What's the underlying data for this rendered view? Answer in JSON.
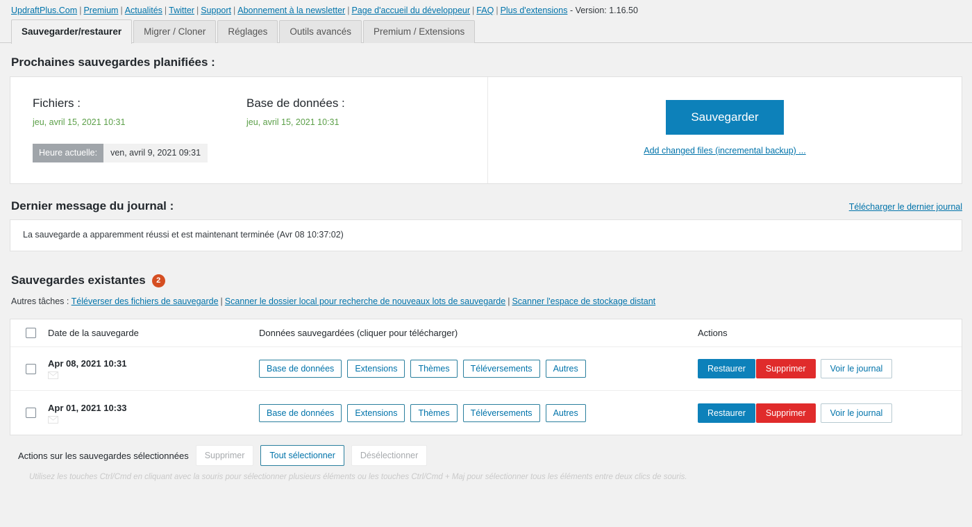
{
  "topbar": {
    "links": [
      "UpdraftPlus.Com",
      "Premium",
      "Actualités",
      "Twitter",
      "Support",
      "Abonnement à la newsletter",
      "Page d'accueil du développeur",
      "FAQ",
      "Plus d'extensions"
    ],
    "separator": "|",
    "version": "- Version: 1.16.50"
  },
  "tabs": [
    {
      "label": "Sauvegarder/restaurer",
      "active": true
    },
    {
      "label": "Migrer / Cloner",
      "active": false
    },
    {
      "label": "Réglages",
      "active": false
    },
    {
      "label": "Outils avancés",
      "active": false
    },
    {
      "label": "Premium / Extensions",
      "active": false
    }
  ],
  "scheduled": {
    "title": "Prochaines sauvegardes planifiées :",
    "files": {
      "label": "Fichiers :",
      "date": "jeu, avril 15, 2021 10:31"
    },
    "database": {
      "label": "Base de données :",
      "date": "jeu, avril 15, 2021 10:31"
    },
    "current_time": {
      "label": "Heure actuelle:",
      "value": "ven, avril 9, 2021 09:31"
    },
    "backup_button": "Sauvegarder",
    "incremental_link": "Add changed files (incremental backup) ..."
  },
  "log": {
    "title": "Dernier message du journal :",
    "download_link": "Télécharger le dernier journal",
    "message": "La sauvegarde a apparemment réussi et est maintenant terminée (Avr 08 10:37:02)"
  },
  "existing": {
    "title": "Sauvegardes existantes",
    "count": "2",
    "tasks_label": "Autres tâches :",
    "tasks": [
      "Téléverser des fichiers de sauvegarde",
      "Scanner le dossier local pour recherche de nouveaux lots de sauvegarde",
      "Scanner l'espace de stockage distant"
    ],
    "separator": "|",
    "columns": {
      "date": "Date de la sauvegarde",
      "data": "Données sauvegardées (cliquer pour télécharger)",
      "actions": "Actions"
    },
    "rows": [
      {
        "date": "Apr 08, 2021 10:31",
        "data_buttons": [
          "Base de données",
          "Extensions",
          "Thèmes",
          "Téléversements",
          "Autres"
        ],
        "actions": {
          "restore": "Restaurer",
          "delete": "Supprimer",
          "viewlog": "Voir le journal"
        }
      },
      {
        "date": "Apr 01, 2021 10:33",
        "data_buttons": [
          "Base de données",
          "Extensions",
          "Thèmes",
          "Téléversements",
          "Autres"
        ],
        "actions": {
          "restore": "Restaurer",
          "delete": "Supprimer",
          "viewlog": "Voir le journal"
        }
      }
    ]
  },
  "footer": {
    "label": "Actions sur les sauvegardes sélectionnées",
    "delete": "Supprimer",
    "select_all": "Tout sélectionner",
    "deselect": "Désélectionner",
    "hint": "Utilisez les touches Ctrl/Cmd en cliquant avec la souris pour sélectionner plusieurs éléments ou les touches Ctrl/Cmd + Maj pour sélectionner tous les éléments entre deux clics de souris."
  },
  "colors": {
    "accent_blue": "#0d81ba",
    "link_blue": "#0073aa",
    "danger_red": "#e02b2b",
    "badge_orange": "#d54e21",
    "schedule_green": "#5b9f48"
  }
}
